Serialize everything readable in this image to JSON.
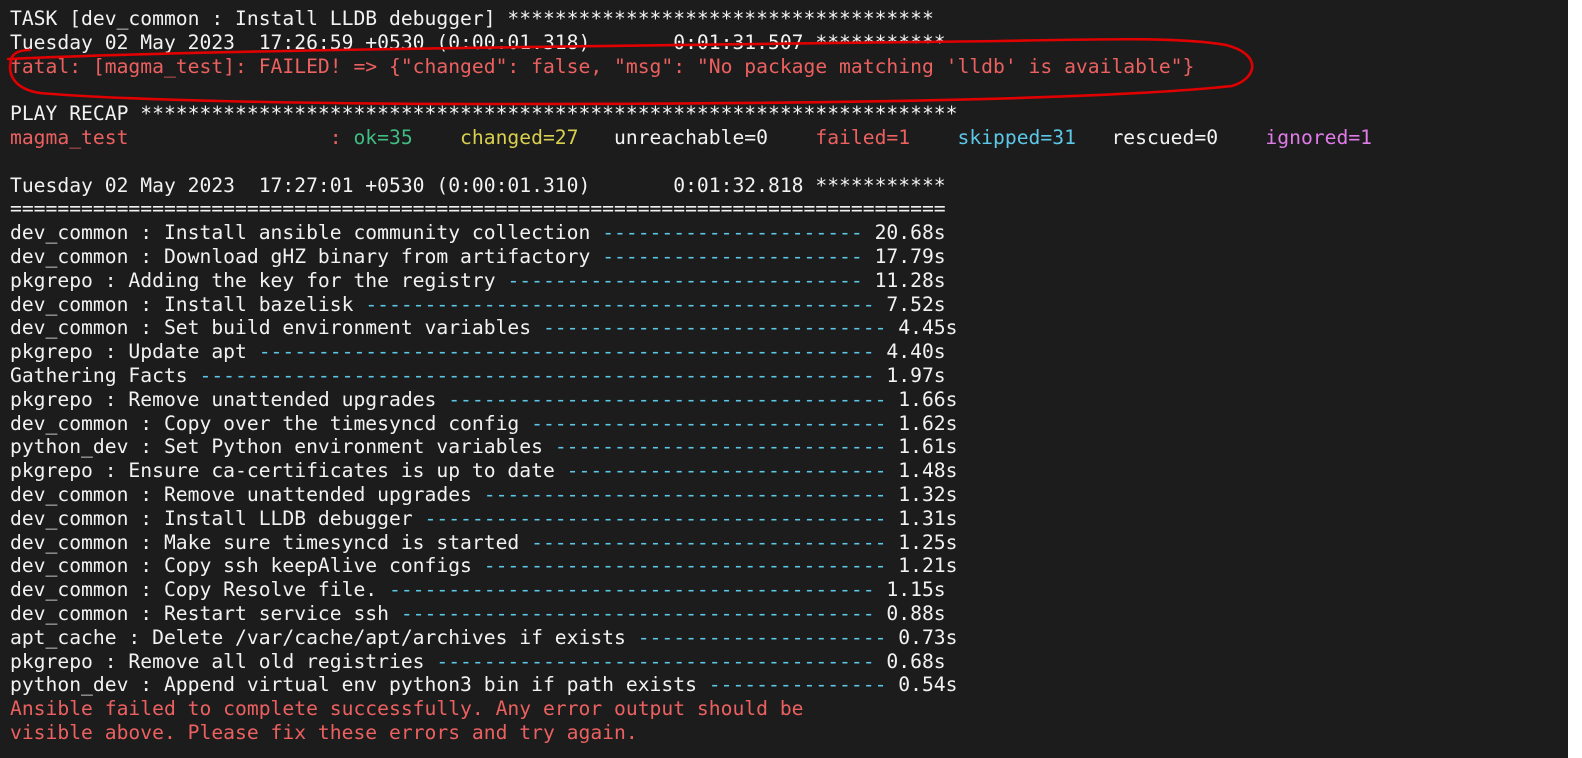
{
  "colors": {
    "background": "#1c1c1c",
    "default": "#f2f2f2",
    "red": "#ec6060",
    "green": "#3fbd82",
    "yellow": "#d8d04e",
    "cyan": "#5cc8e8",
    "magenta": "#e07ce8",
    "annotation": "#e00000"
  },
  "terminal": {
    "lines": [
      [
        {
          "text": "TASK [dev_common : Install LLDB debugger] ************************************",
          "color": "white"
        }
      ],
      [
        {
          "text": "Tuesday 02 May 2023  17:26:59 +0530 (0:00:01.318)       0:01:31.507 ***********",
          "color": "white"
        }
      ],
      [
        {
          "text": "fatal: [magma_test]: FAILED! => {\"changed\": false, \"msg\": \"No package matching 'lldb' is available\"}",
          "color": "red"
        }
      ],
      [],
      [
        {
          "text": "PLAY RECAP *********************************************************************",
          "color": "white"
        }
      ],
      [
        {
          "text": "magma_test                 : ",
          "color": "red"
        },
        {
          "text": "ok=35   ",
          "color": "green"
        },
        {
          "text": " changed=27  ",
          "color": "yellow"
        },
        {
          "text": " unreachable=0   ",
          "color": "white"
        },
        {
          "text": " failed=1   ",
          "color": "red"
        },
        {
          "text": " skipped=31  ",
          "color": "cyan"
        },
        {
          "text": " rescued=0   ",
          "color": "white"
        },
        {
          "text": " ignored=1",
          "color": "magenta"
        }
      ],
      [],
      [
        {
          "text": "Tuesday 02 May 2023  17:27:01 +0530 (0:00:01.310)       0:01:32.818 ***********",
          "color": "white"
        }
      ],
      [
        {
          "text": "===============================================================================",
          "color": "white"
        }
      ],
      [
        {
          "text": "dev_common : Install ansible community collection ",
          "color": "white"
        },
        {
          "text": "----------------------",
          "color": "cyan"
        },
        {
          "text": " 20.68s",
          "color": "white"
        }
      ],
      [
        {
          "text": "dev_common : Download gHZ binary from artifactory ",
          "color": "white"
        },
        {
          "text": "----------------------",
          "color": "cyan"
        },
        {
          "text": " 17.79s",
          "color": "white"
        }
      ],
      [
        {
          "text": "pkgrepo : Adding the key for the registry ",
          "color": "white"
        },
        {
          "text": "------------------------------",
          "color": "cyan"
        },
        {
          "text": " 11.28s",
          "color": "white"
        }
      ],
      [
        {
          "text": "dev_common : Install bazelisk ",
          "color": "white"
        },
        {
          "text": "-------------------------------------------",
          "color": "cyan"
        },
        {
          "text": " 7.52s",
          "color": "white"
        }
      ],
      [
        {
          "text": "dev_common : Set build environment variables ",
          "color": "white"
        },
        {
          "text": "-----------------------------",
          "color": "cyan"
        },
        {
          "text": " 4.45s",
          "color": "white"
        }
      ],
      [
        {
          "text": "pkgrepo : Update apt ",
          "color": "white"
        },
        {
          "text": "----------------------------------------------------",
          "color": "cyan"
        },
        {
          "text": " 4.40s",
          "color": "white"
        }
      ],
      [
        {
          "text": "Gathering Facts ",
          "color": "white"
        },
        {
          "text": "---------------------------------------------------------",
          "color": "cyan"
        },
        {
          "text": " 1.97s",
          "color": "white"
        }
      ],
      [
        {
          "text": "pkgrepo : Remove unattended upgrades ",
          "color": "white"
        },
        {
          "text": "-------------------------------------",
          "color": "cyan"
        },
        {
          "text": " 1.66s",
          "color": "white"
        }
      ],
      [
        {
          "text": "dev_common : Copy over the timesyncd config ",
          "color": "white"
        },
        {
          "text": "------------------------------",
          "color": "cyan"
        },
        {
          "text": " 1.62s",
          "color": "white"
        }
      ],
      [
        {
          "text": "python_dev : Set Python environment variables ",
          "color": "white"
        },
        {
          "text": "----------------------------",
          "color": "cyan"
        },
        {
          "text": " 1.61s",
          "color": "white"
        }
      ],
      [
        {
          "text": "pkgrepo : Ensure ca-certificates is up to date ",
          "color": "white"
        },
        {
          "text": "---------------------------",
          "color": "cyan"
        },
        {
          "text": " 1.48s",
          "color": "white"
        }
      ],
      [
        {
          "text": "dev_common : Remove unattended upgrades ",
          "color": "white"
        },
        {
          "text": "----------------------------------",
          "color": "cyan"
        },
        {
          "text": " 1.32s",
          "color": "white"
        }
      ],
      [
        {
          "text": "dev_common : Install LLDB debugger ",
          "color": "white"
        },
        {
          "text": "---------------------------------------",
          "color": "cyan"
        },
        {
          "text": " 1.31s",
          "color": "white"
        }
      ],
      [
        {
          "text": "dev_common : Make sure timesyncd is started ",
          "color": "white"
        },
        {
          "text": "------------------------------",
          "color": "cyan"
        },
        {
          "text": " 1.25s",
          "color": "white"
        }
      ],
      [
        {
          "text": "dev_common : Copy ssh keepAlive configs ",
          "color": "white"
        },
        {
          "text": "----------------------------------",
          "color": "cyan"
        },
        {
          "text": " 1.21s",
          "color": "white"
        }
      ],
      [
        {
          "text": "dev_common : Copy Resolve file. ",
          "color": "white"
        },
        {
          "text": "-----------------------------------------",
          "color": "cyan"
        },
        {
          "text": " 1.15s",
          "color": "white"
        }
      ],
      [
        {
          "text": "dev_common : Restart service ssh ",
          "color": "white"
        },
        {
          "text": "----------------------------------------",
          "color": "cyan"
        },
        {
          "text": " 0.88s",
          "color": "white"
        }
      ],
      [
        {
          "text": "apt_cache : Delete /var/cache/apt/archives if exists ",
          "color": "white"
        },
        {
          "text": "---------------------",
          "color": "cyan"
        },
        {
          "text": " 0.73s",
          "color": "white"
        }
      ],
      [
        {
          "text": "pkgrepo : Remove all old registries ",
          "color": "white"
        },
        {
          "text": "-------------------------------------",
          "color": "cyan"
        },
        {
          "text": " 0.68s",
          "color": "white"
        }
      ],
      [
        {
          "text": "python_dev : Append virtual env python3 bin if path exists ",
          "color": "white"
        },
        {
          "text": "---------------",
          "color": "cyan"
        },
        {
          "text": " 0.54s",
          "color": "white"
        }
      ],
      [
        {
          "text": "Ansible failed to complete successfully. Any error output should be",
          "color": "red"
        }
      ],
      [
        {
          "text": "visible above. Please fix these errors and try again.",
          "color": "red"
        }
      ]
    ]
  }
}
